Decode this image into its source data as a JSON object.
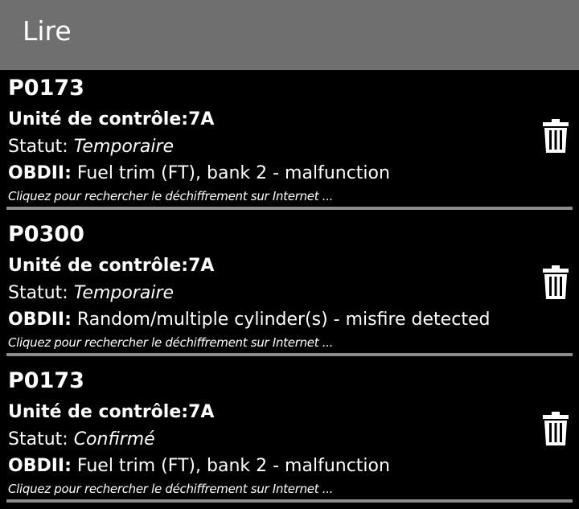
{
  "appbar": {
    "title": "Lire"
  },
  "labels": {
    "unit": "Unité de contrôle:",
    "status": "Statut: ",
    "obd": "OBDII:",
    "hint": "Cliquez pour rechercher le déchiffrement sur Internet ..."
  },
  "icons": {
    "delete": "trash-icon"
  },
  "colors": {
    "appbar_bg": "#6f6f6f",
    "background": "#000000",
    "divider": "#8c8c8c",
    "text": "#ffffff"
  },
  "codes": [
    {
      "code": "P0173",
      "unit": "7A",
      "status": "Temporaire",
      "desc": " Fuel trim (FT), bank 2 - malfunction"
    },
    {
      "code": "P0300",
      "unit": "7A",
      "status": "Temporaire",
      "desc": " Random/multiple cylinder(s) - misfire detected"
    },
    {
      "code": "P0173",
      "unit": "7A",
      "status": "Confirmé",
      "desc": " Fuel trim (FT), bank 2 - malfunction"
    }
  ]
}
